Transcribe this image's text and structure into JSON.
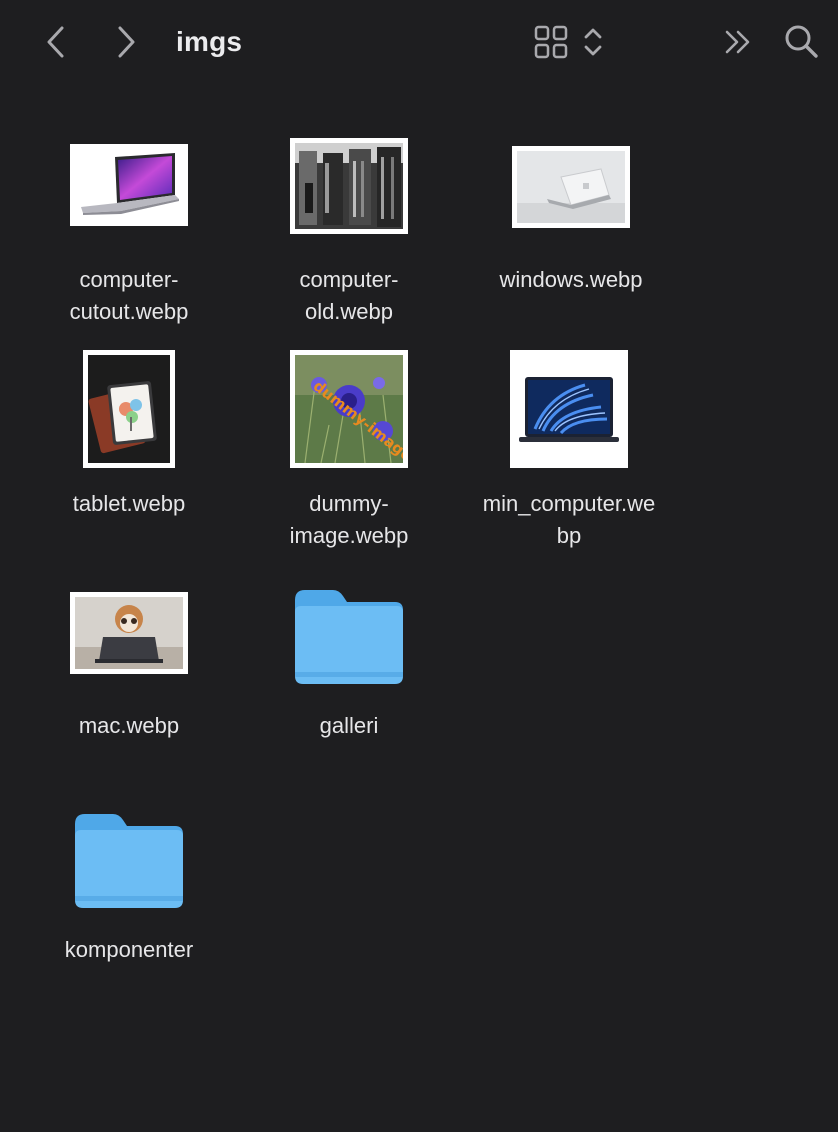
{
  "toolbar": {
    "title": "imgs"
  },
  "icons": {
    "back": "chevron-left-icon",
    "forward": "chevron-right-icon",
    "view": "grid-view-icon",
    "sort": "up-down-chevron-icon",
    "more": "double-chevron-right-icon",
    "search": "magnifier-icon"
  },
  "colors": {
    "background": "#1e1e20",
    "folder": "#6cbdf4",
    "folder_tab": "#4fa8e8",
    "text": "#e6e6e8"
  },
  "files": [
    {
      "line1": "computer-",
      "line2": "cutout.webp"
    },
    {
      "line1": "computer-",
      "line2": "old.webp"
    },
    {
      "line1": "windows.webp",
      "line2": ""
    },
    {
      "line1": "tablet.webp",
      "line2": ""
    },
    {
      "line1": "dummy-",
      "line2": "image.webp"
    },
    {
      "line1": "min_computer.we",
      "line2": "bp"
    },
    {
      "line1": "mac.webp",
      "line2": ""
    },
    {
      "line1": "galleri",
      "line2": ""
    },
    {
      "line1": "komponenter",
      "line2": ""
    }
  ]
}
